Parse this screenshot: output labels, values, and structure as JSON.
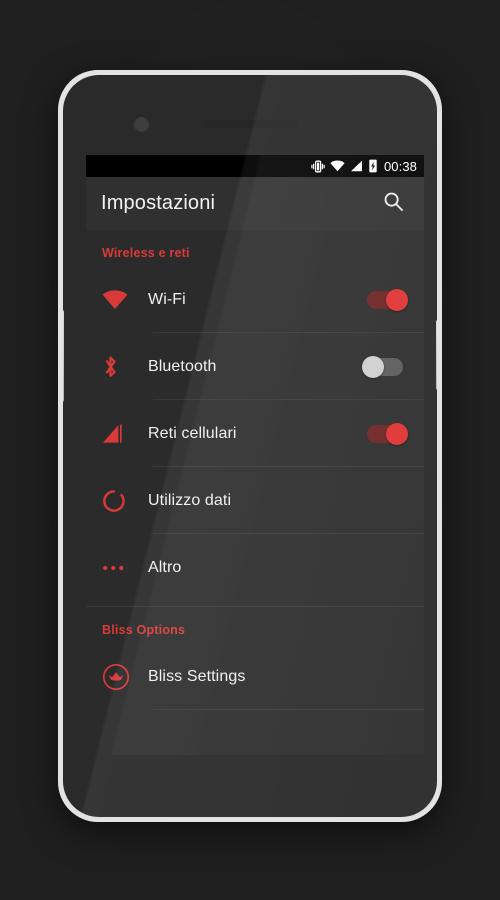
{
  "device": {
    "frame_color": "#d8d8d8",
    "body_color": "#2a2a2a"
  },
  "status_bar": {
    "background": "#000000",
    "clock": "00:38",
    "icons": [
      {
        "name": "vibrate-icon",
        "label": "Vibrate"
      },
      {
        "name": "wifi-status-icon",
        "label": "Wi-Fi signal"
      },
      {
        "name": "cellular-signal-status-icon",
        "label": "Cellular signal"
      },
      {
        "name": "battery-charging-icon",
        "label": "Battery charging"
      }
    ]
  },
  "action_bar": {
    "title": "Impostazioni",
    "search_label": "Cerca",
    "background": "#303030",
    "title_color": "#f2f2f2"
  },
  "theme": {
    "accent": "#d83a3a",
    "screen_background": "#2b2b2b",
    "text_primary": "#f0f0f0",
    "toggle_on_knob": "#e03030",
    "toggle_on_track": "#6e2222",
    "toggle_off_knob": "#cfcfcf",
    "toggle_off_track": "#5a5a5a"
  },
  "sections": [
    {
      "header": "Wireless e reti",
      "rows": [
        {
          "label": "Wi-Fi",
          "icon": "wifi-icon",
          "toggle": "on"
        },
        {
          "label": "Bluetooth",
          "icon": "bluetooth-icon",
          "toggle": "off"
        },
        {
          "label": "Reti cellulari",
          "icon": "cellular-signal-icon",
          "toggle": "on"
        },
        {
          "label": "Utilizzo dati",
          "icon": "data-usage-icon",
          "toggle": null
        },
        {
          "label": "Altro",
          "icon": "more-dots-icon",
          "toggle": null
        }
      ]
    },
    {
      "header": "Bliss Options",
      "rows": [
        {
          "label": "Bliss Settings",
          "icon": "bliss-crown-icon",
          "toggle": null
        }
      ]
    }
  ]
}
